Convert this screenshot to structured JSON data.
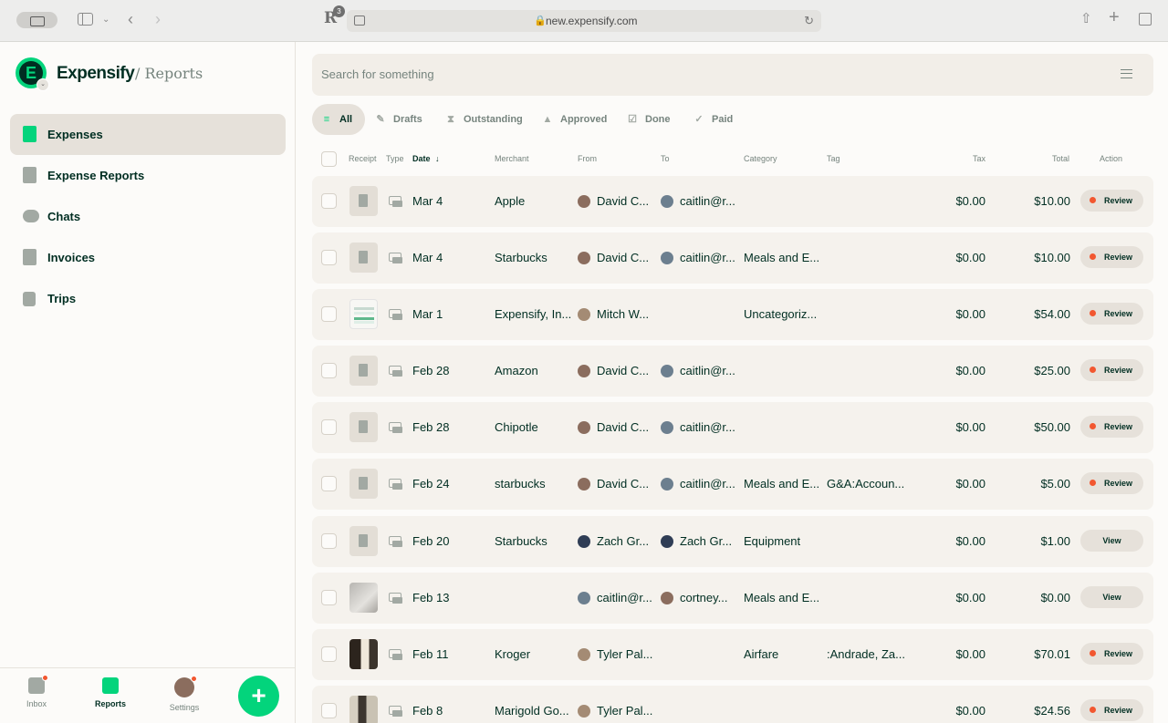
{
  "browser": {
    "extension_badge": "3",
    "url": "new.expensify.com"
  },
  "sidebar": {
    "brand": "Expensify",
    "crumb": "/ Reports",
    "items": [
      {
        "label": "Expenses",
        "icon": "receipt-icon",
        "active": true
      },
      {
        "label": "Expense Reports",
        "icon": "document-icon",
        "active": false
      },
      {
        "label": "Chats",
        "icon": "chat-bubbles-icon",
        "active": false
      },
      {
        "label": "Invoices",
        "icon": "invoice-icon",
        "active": false
      },
      {
        "label": "Trips",
        "icon": "suitcase-icon",
        "active": false
      }
    ],
    "bottom": {
      "inbox": "Inbox",
      "reports": "Reports",
      "settings": "Settings",
      "fab": "+"
    }
  },
  "search": {
    "placeholder": "Search for something"
  },
  "tabs": [
    {
      "label": "All",
      "icon": "stack-icon"
    },
    {
      "label": "Drafts",
      "icon": "pencil-icon"
    },
    {
      "label": "Outstanding",
      "icon": "hourglass-icon"
    },
    {
      "label": "Approved",
      "icon": "thumbs-up-icon"
    },
    {
      "label": "Done",
      "icon": "checkbox-icon"
    },
    {
      "label": "Paid",
      "icon": "checkmark-icon"
    }
  ],
  "table": {
    "headers": {
      "receipt": "Receipt",
      "type": "Type",
      "date": "Date",
      "merchant": "Merchant",
      "from": "From",
      "to": "To",
      "category": "Category",
      "tag": "Tag",
      "tax": "Tax",
      "total": "Total",
      "action": "Action"
    },
    "rows": [
      {
        "date": "Mar 4",
        "merchant": "Apple",
        "from": "David C...",
        "to": "caitlin@r...",
        "category": "",
        "tag": "",
        "tax": "$0.00",
        "total": "$10.00",
        "action": "Review"
      },
      {
        "date": "Mar 4",
        "merchant": "Starbucks",
        "from": "David C...",
        "to": "caitlin@r...",
        "category": "Meals and E...",
        "tag": "",
        "tax": "$0.00",
        "total": "$10.00",
        "action": "Review"
      },
      {
        "date": "Mar 1",
        "merchant": "Expensify, In...",
        "from": "Mitch W...",
        "to": "",
        "category": "Uncategoriz...",
        "tag": "",
        "tax": "$0.00",
        "total": "$54.00",
        "action": "Review"
      },
      {
        "date": "Feb 28",
        "merchant": "Amazon",
        "from": "David C...",
        "to": "caitlin@r...",
        "category": "",
        "tag": "",
        "tax": "$0.00",
        "total": "$25.00",
        "action": "Review"
      },
      {
        "date": "Feb 28",
        "merchant": "Chipotle",
        "from": "David C...",
        "to": "caitlin@r...",
        "category": "",
        "tag": "",
        "tax": "$0.00",
        "total": "$50.00",
        "action": "Review"
      },
      {
        "date": "Feb 24",
        "merchant": "starbucks",
        "from": "David C...",
        "to": "caitlin@r...",
        "category": "Meals and E...",
        "tag": "G&A:Accoun...",
        "tax": "$0.00",
        "total": "$5.00",
        "action": "Review"
      },
      {
        "date": "Feb 20",
        "merchant": "Starbucks",
        "from": "Zach Gr...",
        "to": "Zach Gr...",
        "category": "Equipment",
        "tag": "",
        "tax": "$0.00",
        "total": "$1.00",
        "action": "View"
      },
      {
        "date": "Feb 13",
        "merchant": "",
        "from": "caitlin@r...",
        "to": "cortney...",
        "category": "Meals and E...",
        "tag": "",
        "tax": "$0.00",
        "total": "$0.00",
        "action": "View"
      },
      {
        "date": "Feb 11",
        "merchant": "Kroger",
        "from": "Tyler Pal...",
        "to": "",
        "category": "Airfare",
        "tag": ":Andrade, Za...",
        "tax": "$0.00",
        "total": "$70.01",
        "action": "Review"
      },
      {
        "date": "Feb 8",
        "merchant": "Marigold Go...",
        "from": "Tyler Pal...",
        "to": "",
        "category": "",
        "tag": "",
        "tax": "$0.00",
        "total": "$24.56",
        "action": "Review"
      }
    ]
  },
  "colors": {
    "brand_green": "#03d47c",
    "dark_text": "#002e22",
    "muted_text": "#76847e",
    "row_bg": "#f5f2ed",
    "alert_dot": "#f25730"
  }
}
